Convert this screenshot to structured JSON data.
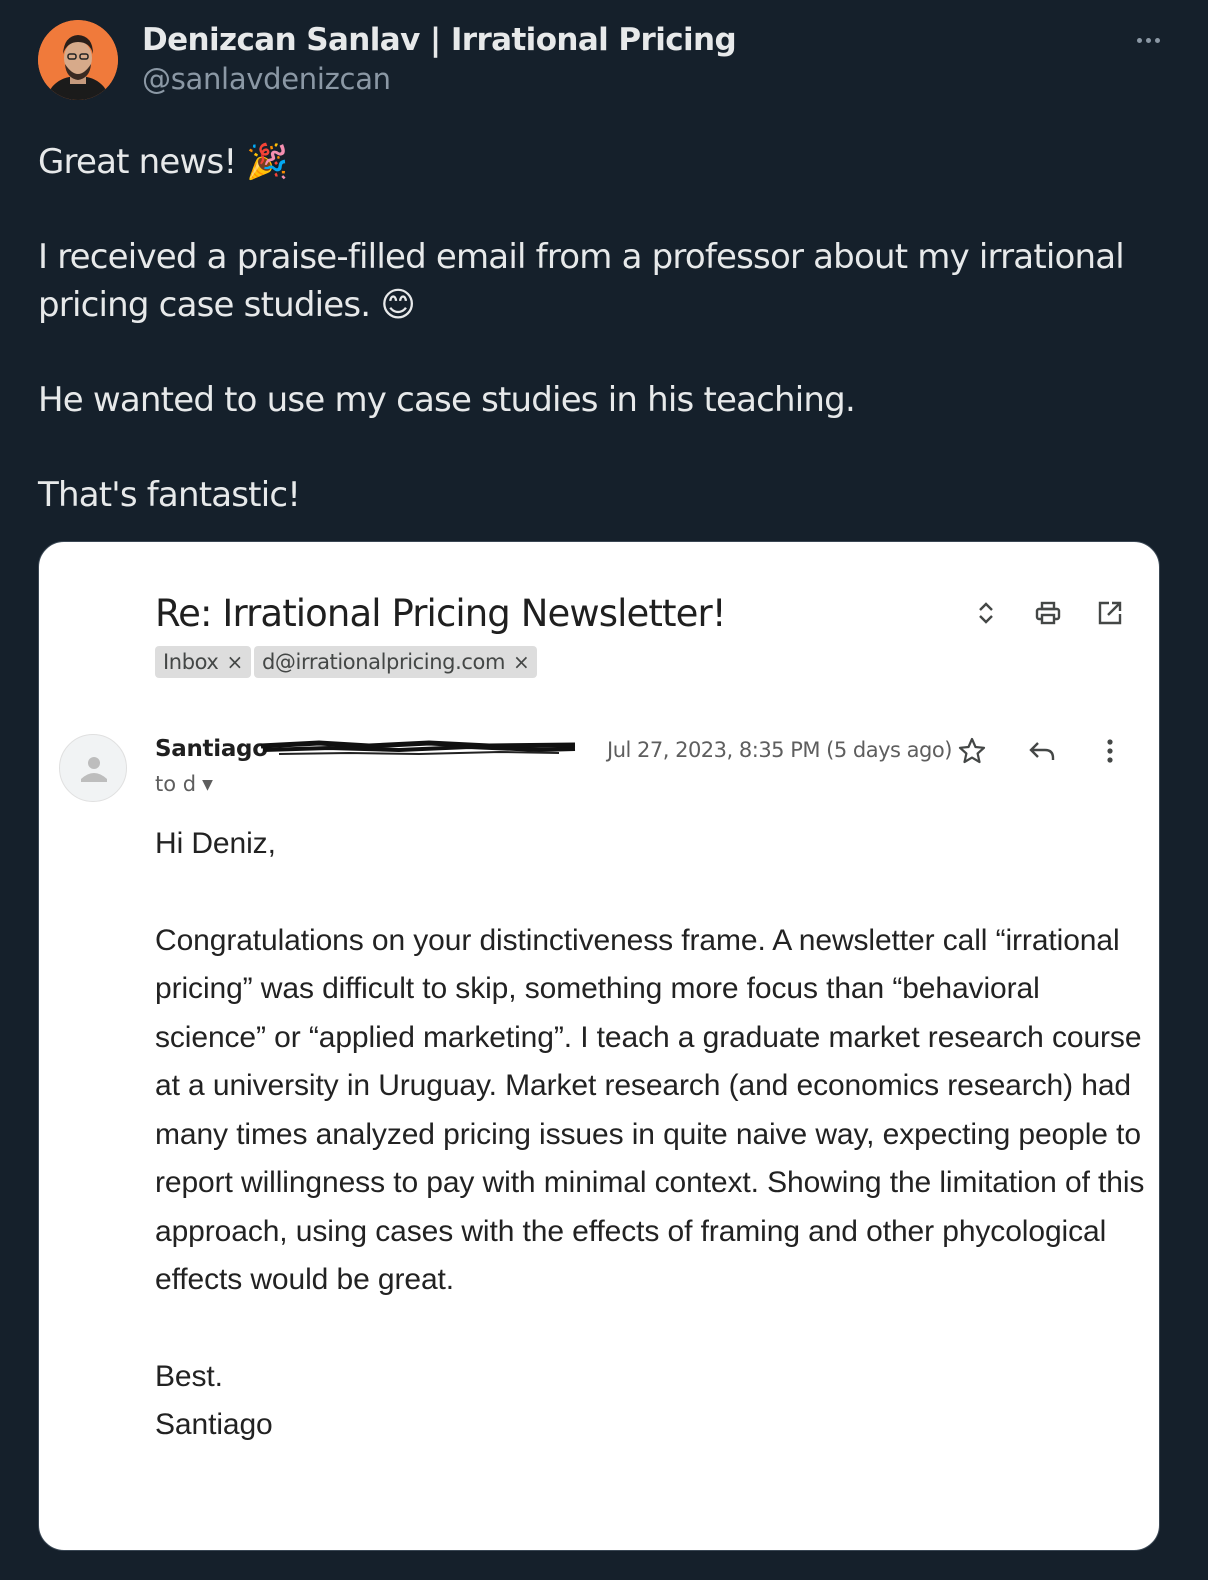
{
  "tweet": {
    "author_name": "Denizcan Sanlav | Irrational Pricing",
    "author_handle": "@sanlavdenizcan",
    "paragraphs": [
      "Great news! 🎉",
      "I received a praise-filled email from a professor about my irrational pricing case studies. 😊",
      "He wanted to use my case studies in his teaching.",
      "That's fantastic!"
    ],
    "icons": {
      "more": "more-horizontal-icon",
      "celebrate": "party-popper-emoji",
      "smile": "smiling-face-emoji"
    }
  },
  "email": {
    "subject": "Re: Irrational Pricing Newsletter!",
    "labels": [
      {
        "text": "Inbox",
        "remove": "×"
      },
      {
        "text": "d@irrationalpricing.com",
        "remove": "×"
      }
    ],
    "sender_name": "Santiago",
    "to_line": "to d",
    "date": "Jul 27, 2023, 8:35 PM (5 days ago)",
    "greeting": "Hi Deniz,",
    "body": "Congratulations on your distinctiveness frame. A newsletter call “irrational pricing” was difficult to skip, something more focus than “behavioral science” or “applied marketing”. I teach a graduate market research course at a university in Uruguay.  Market research (and economics research) had many times analyzed pricing issues in quite naive way, expecting people to report willingness to pay with minimal context. Showing the limitation of this approach, using cases with the effects of framing and other phycological effects would be great.",
    "signoff": "Best.",
    "signature": "Santiago",
    "icons": [
      "expand-collapse-icon",
      "print-icon",
      "open-in-new-window-icon",
      "star-icon",
      "reply-icon",
      "more-vertical-icon"
    ]
  }
}
